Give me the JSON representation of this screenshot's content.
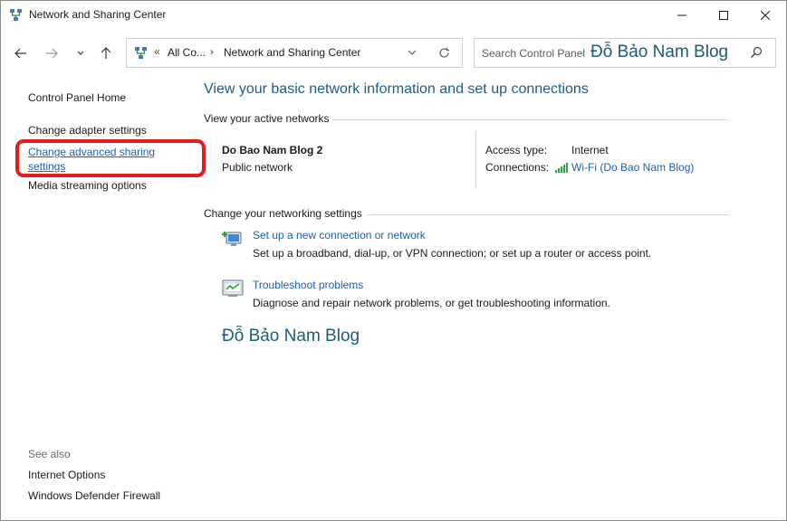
{
  "window": {
    "title": "Network and Sharing Center",
    "controls": {
      "minimize": "minimize-icon",
      "maximize": "maximize-icon",
      "close": "close-icon"
    }
  },
  "nav": {
    "address": {
      "overflow": "«",
      "crumb1": "All Co...",
      "separator": "›",
      "crumb2": "Network and Sharing Center"
    },
    "search": {
      "placeholder": "Search Control Panel",
      "watermark": "Đỗ Bảo Nam Blog"
    }
  },
  "sidebar": {
    "home": "Control Panel Home",
    "adapter": "Change adapter settings",
    "advanced": "Change advanced sharing settings",
    "media": "Media streaming options",
    "see_also": "See also",
    "internet_options": "Internet Options",
    "firewall": "Windows Defender Firewall"
  },
  "main": {
    "title": "View your basic network information and set up connections",
    "active_networks_heading": "View your active networks",
    "network": {
      "name": "Do Bao Nam Blog 2",
      "type": "Public network",
      "access_label": "Access type:",
      "access_value": "Internet",
      "connections_label": "Connections:",
      "connection_link": "Wi-Fi (Do Bao Nam Blog)"
    },
    "change_heading": "Change your networking settings",
    "tasks": [
      {
        "link": "Set up a new connection or network",
        "desc": "Set up a broadband, dial-up, or VPN connection; or set up a router or access point."
      },
      {
        "link": "Troubleshoot problems",
        "desc": "Diagnose and repair network problems, or get troubleshooting information."
      }
    ],
    "watermark": "Đỗ Bảo Nam Blog"
  },
  "colors": {
    "link": "#1a5fb4",
    "title": "#1e5a8a",
    "highlight": "#e51c1c"
  }
}
